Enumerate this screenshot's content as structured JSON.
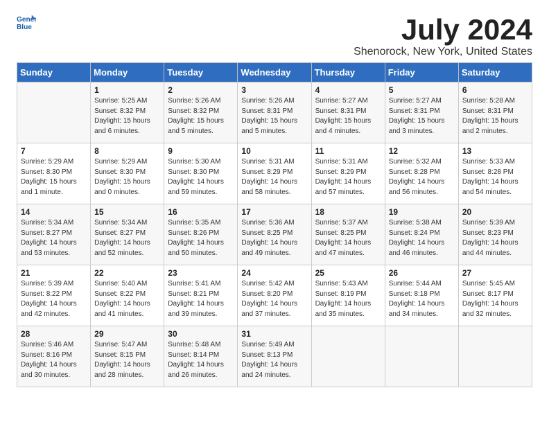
{
  "logo": {
    "text_general": "General",
    "text_blue": "Blue"
  },
  "title": "July 2024",
  "location": "Shenorock, New York, United States",
  "days_of_week": [
    "Sunday",
    "Monday",
    "Tuesday",
    "Wednesday",
    "Thursday",
    "Friday",
    "Saturday"
  ],
  "weeks": [
    [
      {
        "day": "",
        "content": ""
      },
      {
        "day": "1",
        "content": "Sunrise: 5:25 AM\nSunset: 8:32 PM\nDaylight: 15 hours\nand 6 minutes."
      },
      {
        "day": "2",
        "content": "Sunrise: 5:26 AM\nSunset: 8:32 PM\nDaylight: 15 hours\nand 5 minutes."
      },
      {
        "day": "3",
        "content": "Sunrise: 5:26 AM\nSunset: 8:31 PM\nDaylight: 15 hours\nand 5 minutes."
      },
      {
        "day": "4",
        "content": "Sunrise: 5:27 AM\nSunset: 8:31 PM\nDaylight: 15 hours\nand 4 minutes."
      },
      {
        "day": "5",
        "content": "Sunrise: 5:27 AM\nSunset: 8:31 PM\nDaylight: 15 hours\nand 3 minutes."
      },
      {
        "day": "6",
        "content": "Sunrise: 5:28 AM\nSunset: 8:31 PM\nDaylight: 15 hours\nand 2 minutes."
      }
    ],
    [
      {
        "day": "7",
        "content": "Sunrise: 5:29 AM\nSunset: 8:30 PM\nDaylight: 15 hours\nand 1 minute."
      },
      {
        "day": "8",
        "content": "Sunrise: 5:29 AM\nSunset: 8:30 PM\nDaylight: 15 hours\nand 0 minutes."
      },
      {
        "day": "9",
        "content": "Sunrise: 5:30 AM\nSunset: 8:30 PM\nDaylight: 14 hours\nand 59 minutes."
      },
      {
        "day": "10",
        "content": "Sunrise: 5:31 AM\nSunset: 8:29 PM\nDaylight: 14 hours\nand 58 minutes."
      },
      {
        "day": "11",
        "content": "Sunrise: 5:31 AM\nSunset: 8:29 PM\nDaylight: 14 hours\nand 57 minutes."
      },
      {
        "day": "12",
        "content": "Sunrise: 5:32 AM\nSunset: 8:28 PM\nDaylight: 14 hours\nand 56 minutes."
      },
      {
        "day": "13",
        "content": "Sunrise: 5:33 AM\nSunset: 8:28 PM\nDaylight: 14 hours\nand 54 minutes."
      }
    ],
    [
      {
        "day": "14",
        "content": "Sunrise: 5:34 AM\nSunset: 8:27 PM\nDaylight: 14 hours\nand 53 minutes."
      },
      {
        "day": "15",
        "content": "Sunrise: 5:34 AM\nSunset: 8:27 PM\nDaylight: 14 hours\nand 52 minutes."
      },
      {
        "day": "16",
        "content": "Sunrise: 5:35 AM\nSunset: 8:26 PM\nDaylight: 14 hours\nand 50 minutes."
      },
      {
        "day": "17",
        "content": "Sunrise: 5:36 AM\nSunset: 8:25 PM\nDaylight: 14 hours\nand 49 minutes."
      },
      {
        "day": "18",
        "content": "Sunrise: 5:37 AM\nSunset: 8:25 PM\nDaylight: 14 hours\nand 47 minutes."
      },
      {
        "day": "19",
        "content": "Sunrise: 5:38 AM\nSunset: 8:24 PM\nDaylight: 14 hours\nand 46 minutes."
      },
      {
        "day": "20",
        "content": "Sunrise: 5:39 AM\nSunset: 8:23 PM\nDaylight: 14 hours\nand 44 minutes."
      }
    ],
    [
      {
        "day": "21",
        "content": "Sunrise: 5:39 AM\nSunset: 8:22 PM\nDaylight: 14 hours\nand 42 minutes."
      },
      {
        "day": "22",
        "content": "Sunrise: 5:40 AM\nSunset: 8:22 PM\nDaylight: 14 hours\nand 41 minutes."
      },
      {
        "day": "23",
        "content": "Sunrise: 5:41 AM\nSunset: 8:21 PM\nDaylight: 14 hours\nand 39 minutes."
      },
      {
        "day": "24",
        "content": "Sunrise: 5:42 AM\nSunset: 8:20 PM\nDaylight: 14 hours\nand 37 minutes."
      },
      {
        "day": "25",
        "content": "Sunrise: 5:43 AM\nSunset: 8:19 PM\nDaylight: 14 hours\nand 35 minutes."
      },
      {
        "day": "26",
        "content": "Sunrise: 5:44 AM\nSunset: 8:18 PM\nDaylight: 14 hours\nand 34 minutes."
      },
      {
        "day": "27",
        "content": "Sunrise: 5:45 AM\nSunset: 8:17 PM\nDaylight: 14 hours\nand 32 minutes."
      }
    ],
    [
      {
        "day": "28",
        "content": "Sunrise: 5:46 AM\nSunset: 8:16 PM\nDaylight: 14 hours\nand 30 minutes."
      },
      {
        "day": "29",
        "content": "Sunrise: 5:47 AM\nSunset: 8:15 PM\nDaylight: 14 hours\nand 28 minutes."
      },
      {
        "day": "30",
        "content": "Sunrise: 5:48 AM\nSunset: 8:14 PM\nDaylight: 14 hours\nand 26 minutes."
      },
      {
        "day": "31",
        "content": "Sunrise: 5:49 AM\nSunset: 8:13 PM\nDaylight: 14 hours\nand 24 minutes."
      },
      {
        "day": "",
        "content": ""
      },
      {
        "day": "",
        "content": ""
      },
      {
        "day": "",
        "content": ""
      }
    ]
  ]
}
